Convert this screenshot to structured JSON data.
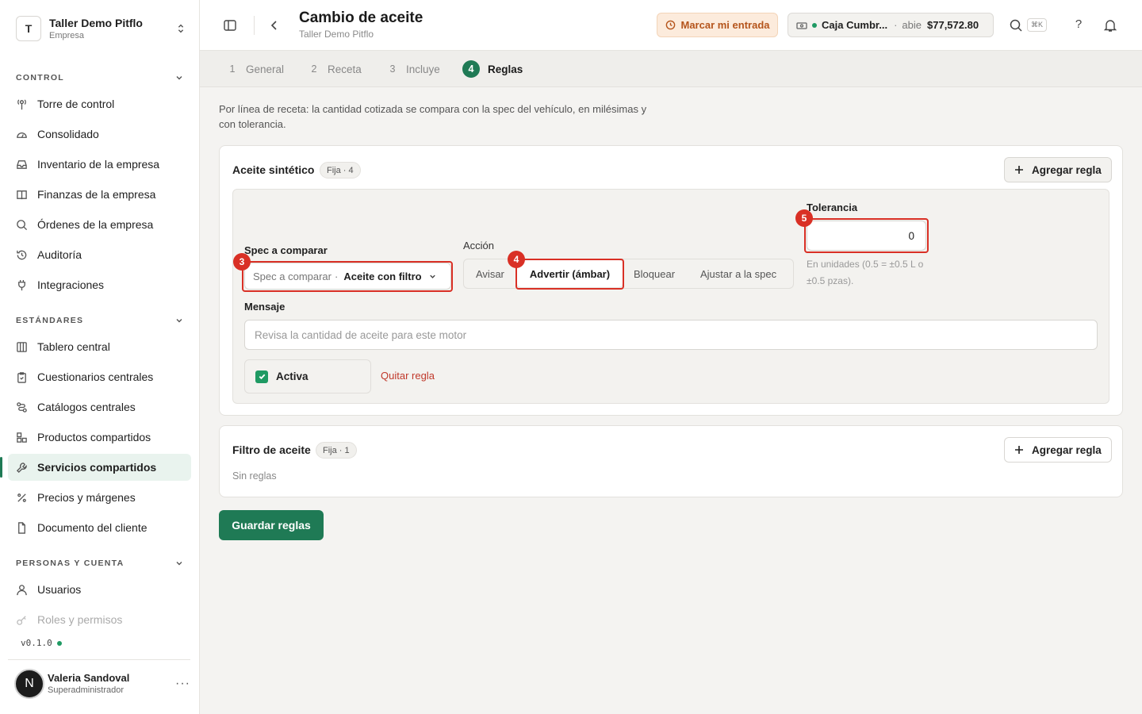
{
  "org": {
    "initial": "T",
    "name": "Taller Demo Pitflo",
    "type": "Empresa"
  },
  "sidebar": {
    "sections": [
      {
        "title": "CONTROL"
      },
      {
        "title": "ESTÁNDARES"
      },
      {
        "title": "PERSONAS Y CUENTA"
      }
    ],
    "control_items": [
      {
        "label": "Torre de control",
        "icon": "tower-icon"
      },
      {
        "label": "Consolidado",
        "icon": "gauge-icon"
      },
      {
        "label": "Inventario de la empresa",
        "icon": "inbox-icon"
      },
      {
        "label": "Finanzas de la empresa",
        "icon": "book-icon"
      },
      {
        "label": "Órdenes de la empresa",
        "icon": "search-icon"
      },
      {
        "label": "Auditoría",
        "icon": "history-icon"
      },
      {
        "label": "Integraciones",
        "icon": "plug-icon"
      }
    ],
    "standards_items": [
      {
        "label": "Tablero central",
        "icon": "columns-icon"
      },
      {
        "label": "Cuestionarios centrales",
        "icon": "clipboard-icon"
      },
      {
        "label": "Catálogos centrales",
        "icon": "route-icon"
      },
      {
        "label": "Productos compartidos",
        "icon": "boxes-icon"
      },
      {
        "label": "Servicios compartidos",
        "icon": "wrench-icon"
      },
      {
        "label": "Precios y márgenes",
        "icon": "percent-icon"
      },
      {
        "label": "Documento del cliente",
        "icon": "file-icon"
      }
    ],
    "people_items": [
      {
        "label": "Usuarios",
        "icon": "user-icon"
      },
      {
        "label": "Roles y permisos",
        "icon": "key-icon"
      }
    ],
    "version": "v0.1.0"
  },
  "user": {
    "initial": "N",
    "name": "Valeria Sandoval",
    "role": "Superadministrador"
  },
  "header": {
    "title": "Cambio de aceite",
    "subtitle": "Taller Demo Pitflo",
    "clock_in_label": "Marcar mi entrada",
    "register": {
      "name": "Caja Cumbr...",
      "status": "abie",
      "amount": "$77,572.80"
    },
    "shortcut": "⌘K",
    "help": "?"
  },
  "steps": [
    {
      "num": "1",
      "label": "General"
    },
    {
      "num": "2",
      "label": "Receta"
    },
    {
      "num": "3",
      "label": "Incluye"
    },
    {
      "num": "4",
      "label": "Reglas"
    }
  ],
  "description": "Por línea de receta: la cantidad cotizada se compara con la spec del vehículo, en milésimas y con tolerancia.",
  "groups": [
    {
      "title": "Aceite sintético",
      "badge": "Fija · 4",
      "add_label": "Agregar regla",
      "rule": {
        "spec_label": "Spec a comparar",
        "spec_placeholder": "Spec a comparar",
        "spec_value": "Aceite con filtro",
        "action_label": "Acción",
        "actions": [
          "Avisar",
          "Advertir (ámbar)",
          "Bloquear",
          "Ajustar a la spec"
        ],
        "selected_action": "Advertir (ámbar)",
        "tolerance_label": "Tolerancia",
        "tolerance_value": "0",
        "tolerance_hint": "En unidades (0.5 = ±0.5 L o ±0.5 pzas).",
        "message_label": "Mensaje",
        "message_placeholder": "Revisa la cantidad de aceite para este motor",
        "active_label": "Activa",
        "active": true,
        "remove_label": "Quitar regla"
      }
    },
    {
      "title": "Filtro de aceite",
      "badge": "Fija · 1",
      "add_label": "Agregar regla",
      "empty_label": "Sin reglas"
    }
  ],
  "save_label": "Guardar reglas",
  "markers": [
    "3",
    "4",
    "5"
  ],
  "colors": {
    "primary": "#1f7a55",
    "highlight": "#d93025",
    "warning_bg": "#fcebdc",
    "warning_text": "#b5551c",
    "danger_text": "#c0392b"
  }
}
